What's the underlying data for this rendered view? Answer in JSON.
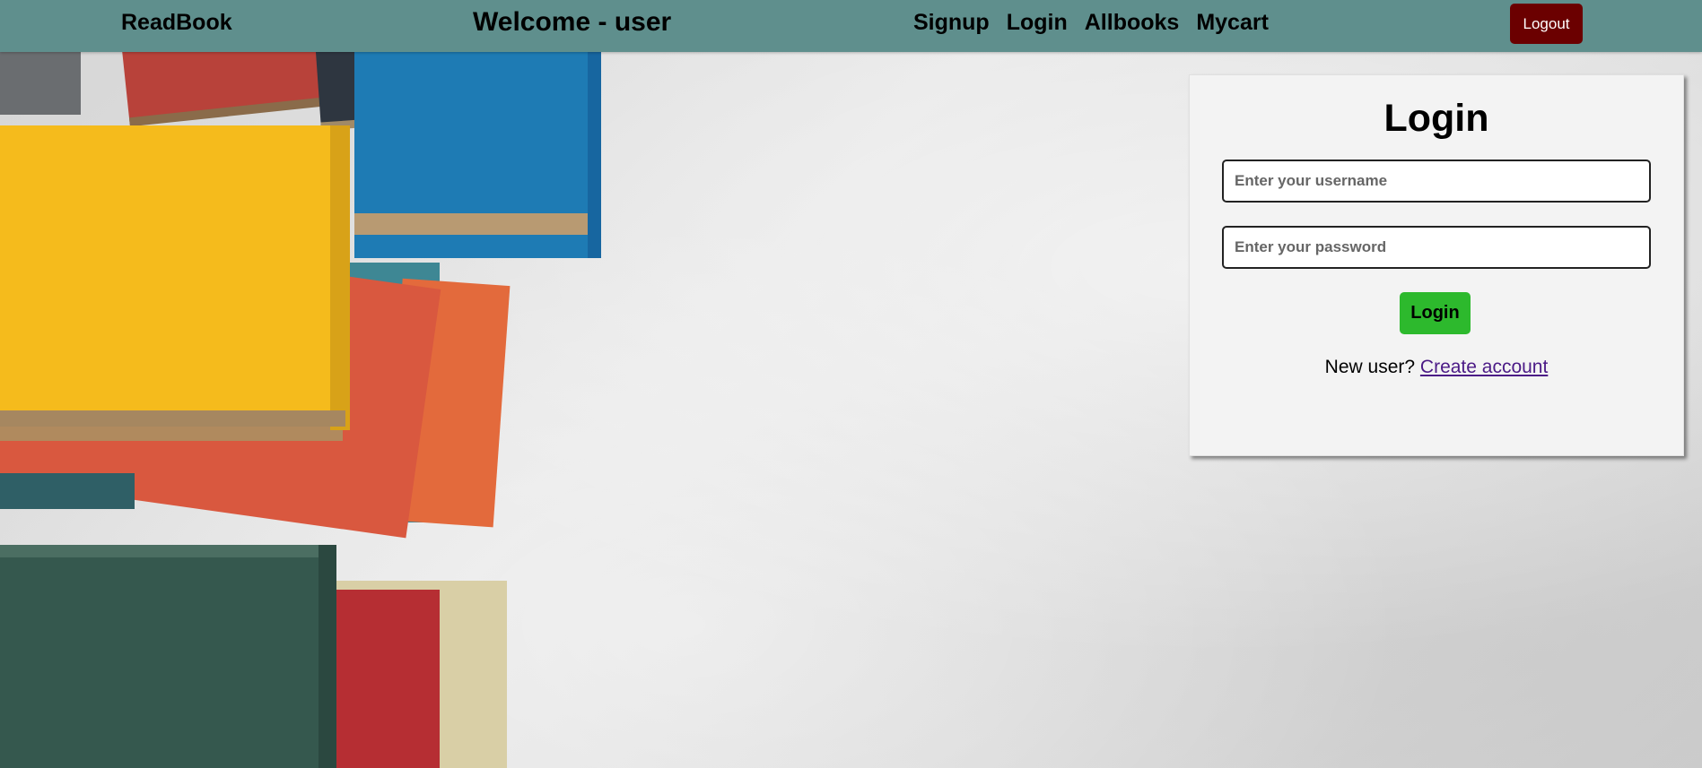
{
  "nav": {
    "brand": "ReadBook",
    "welcome": "Welcome - user",
    "links": [
      "Signup",
      "Login",
      "Allbooks",
      "Mycart"
    ],
    "logout_label": "Logout"
  },
  "login": {
    "title": "Login",
    "username_placeholder": "Enter your username",
    "password_placeholder": "Enter your password",
    "submit_label": "Login",
    "new_user_text": "New user?",
    "create_account_label": "Create account"
  },
  "colors": {
    "navbar_bg": "#5f8f8d",
    "logout_bg": "#6b0000",
    "login_button_bg": "#2db92d",
    "link_color": "#4b1a86"
  }
}
